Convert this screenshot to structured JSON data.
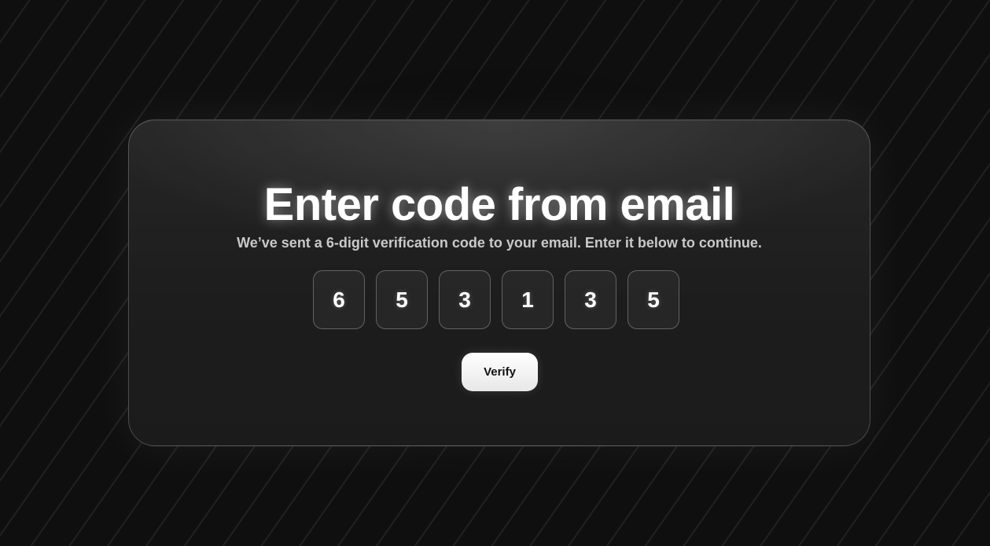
{
  "card": {
    "title": "Enter code from email",
    "subtitle": "We’ve sent a 6-digit verification code to your email. Enter it below to continue."
  },
  "code": {
    "digits": [
      "6",
      "5",
      "3",
      "1",
      "3",
      "5"
    ]
  },
  "actions": {
    "verify_label": "Verify"
  },
  "colors": {
    "background": "#0f0f0f",
    "card": "#1e1e1e",
    "text": "#ffffff",
    "subtitle": "#c9c9c9",
    "button": "#ffffff"
  }
}
